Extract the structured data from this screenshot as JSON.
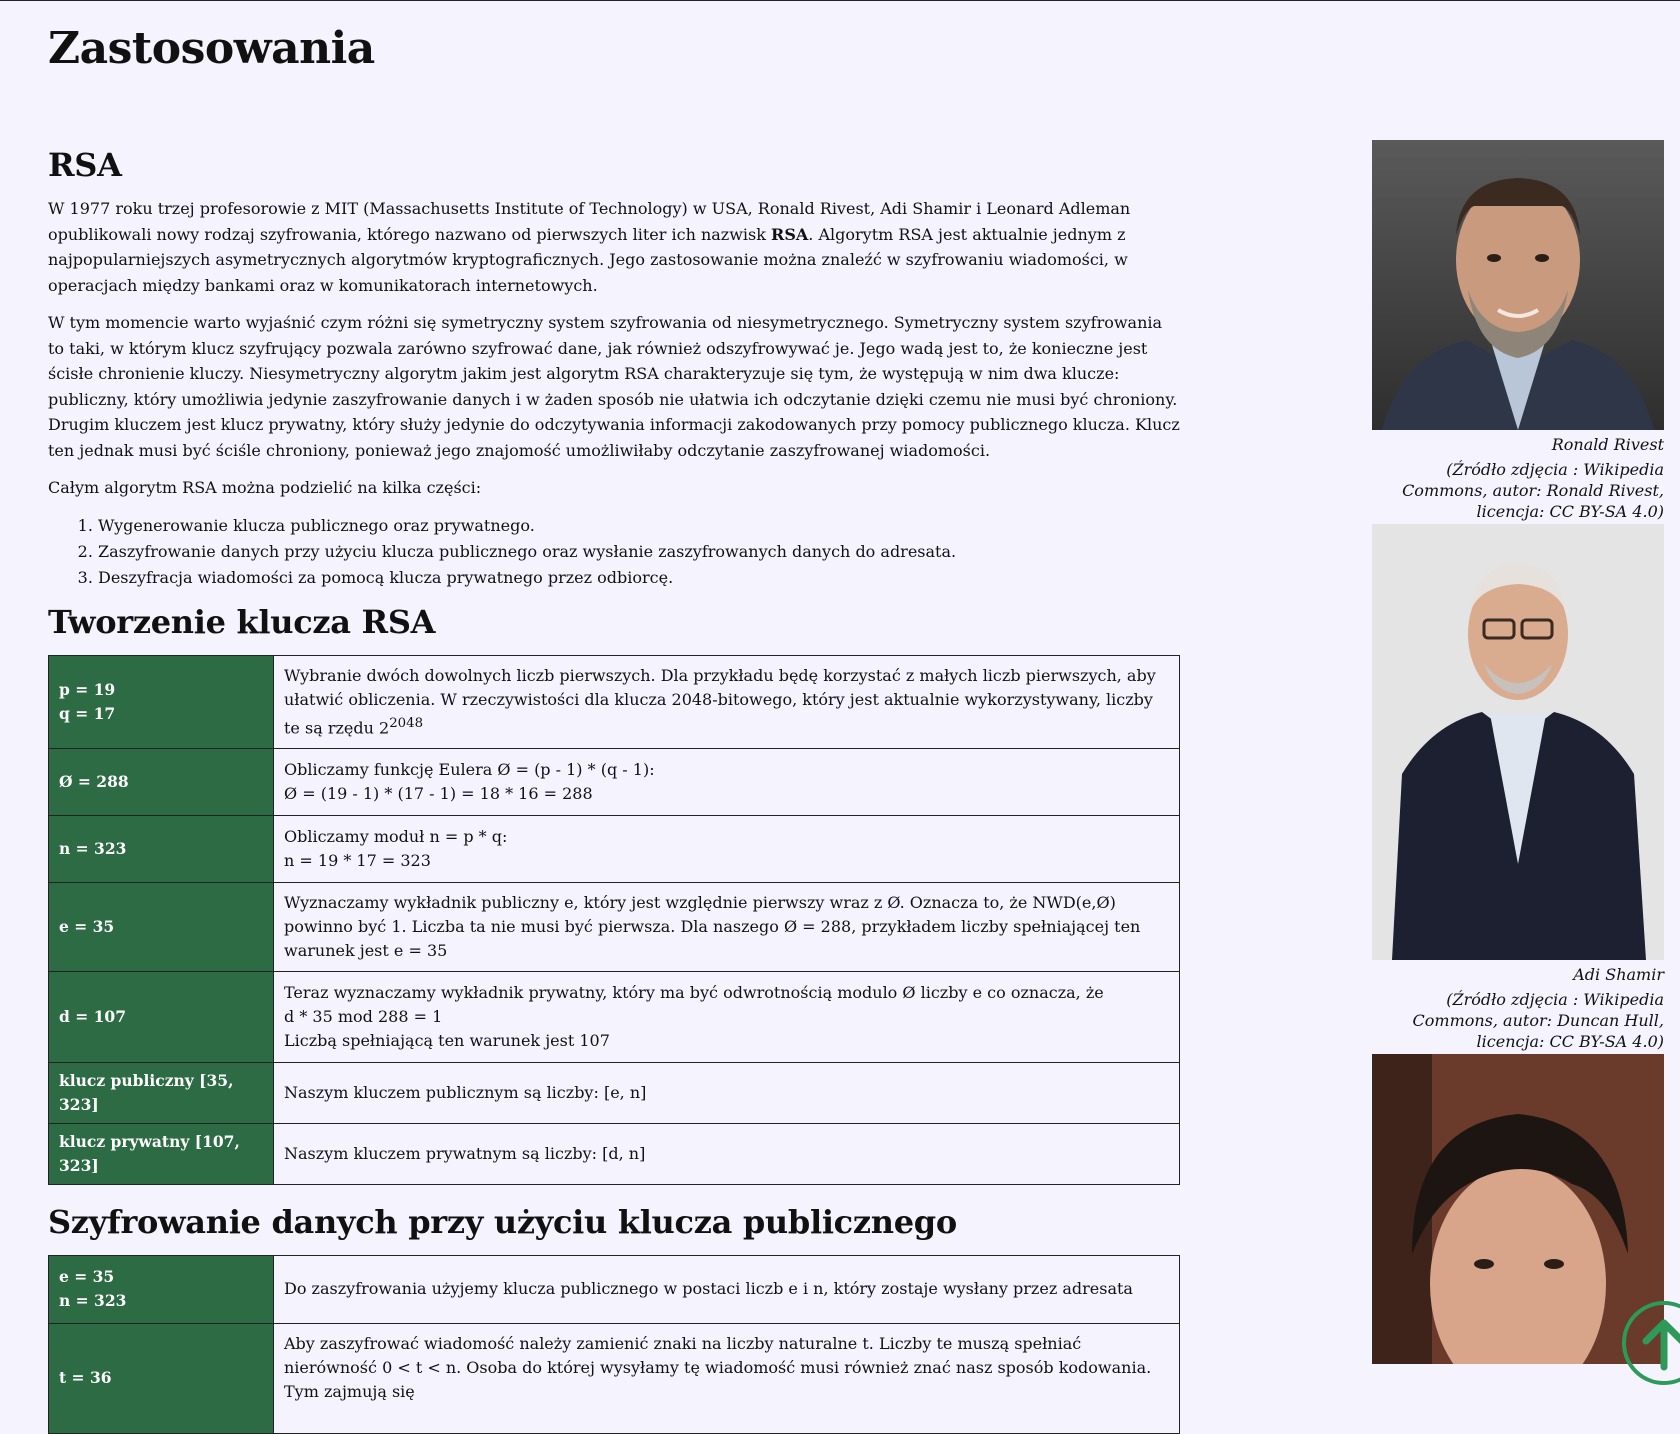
{
  "page": {
    "title": "Zastosowania"
  },
  "rsa": {
    "heading": "RSA",
    "para1_a": "W 1977 roku trzej profesorowie z MIT (Massachusetts Institute of Technology) w USA, Ronald Rivest, Adi Shamir i Leonard Adleman opublikowali nowy rodzaj szyfrowania, którego nazwano od pierwszych liter ich nazwisk ",
    "para1_bold": "RSA",
    "para1_b": ". Algorytm RSA jest aktualnie jednym z najpopularniejszych asymetrycznych algorytmów kryptograficznych. Jego zastosowanie można znaleźć w szyfrowaniu wiadomości, w operacjach między bankami oraz w komunikatorach internetowych.",
    "para2": "W tym momencie warto wyjaśnić czym różni się symetryczny system szyfrowania od niesymetrycznego. Symetryczny system szyfrowania to taki, w którym klucz szyfrujący pozwala zarówno szyfrować dane, jak również odszyfrowywać je. Jego wadą jest to, że konieczne jest ścisłe chronienie kluczy. Niesymetryczny algorytm jakim jest algorytm RSA charakteryzuje się tym, że występują w nim dwa klucze: publiczny, który umożliwia jedynie zaszyfrowanie danych i w żaden sposób nie ułatwia ich odczytanie dzięki czemu nie musi być chroniony. Drugim kluczem jest klucz prywatny, który służy jedynie do odczytywania informacji zakodowanych przy pomocy publicznego klucza. Klucz ten jednak musi być ściśle chroniony, ponieważ jego znajomość umożliwiłaby odczytanie zaszyfrowanej wiadomości.",
    "para3": "Całym algorytm RSA można podzielić na kilka części:",
    "steps": [
      "Wygenerowanie klucza publicznego oraz prywatnego.",
      "Zaszyfrowanie danych przy użyciu klucza publicznego oraz wysłanie zaszyfrowanych danych do adresata.",
      "Deszyfracja wiadomości za pomocą klucza prywatnego przez odbiorcę."
    ]
  },
  "keygen": {
    "heading": "Tworzenie klucza RSA",
    "rows": [
      {
        "k1": "p = 19",
        "k2": "q = 17",
        "v1": "Wybranie dwóch dowolnych liczb pierwszych. Dla przykładu będę korzystać z małych liczb pierwszych, aby ułatwić obliczenia. W rzeczywistości dla klucza 2048-bitowego, który jest aktualnie wykorzystywany, liczby te są rzędu 2",
        "v1_sup": "2048"
      },
      {
        "k1": "Ø = 288",
        "v1": "Obliczamy funkcję Eulera Ø = (p - 1) * (q - 1):",
        "v2": "Ø = (19 - 1) * (17 - 1) = 18 * 16 = 288"
      },
      {
        "k1": "n = 323",
        "v1": "Obliczamy moduł n = p * q:",
        "v2": "n = 19 * 17 = 323"
      },
      {
        "k1": "e = 35",
        "v1": "Wyznaczamy wykładnik publiczny e, który jest względnie pierwszy wraz z Ø. Oznacza to, że NWD(e,Ø) powinno być 1. Liczba ta nie musi być pierwsza. Dla naszego Ø = 288, przykładem liczby spełniającej ten warunek jest e = 35"
      },
      {
        "k1": "d = 107",
        "v1": "Teraz wyznaczamy wykładnik prywatny, który ma być odwrotnością modulo Ø liczby e co oznacza, że",
        "v2": "d * 35 mod 288 = 1",
        "v3": "Liczbą spełniającą ten warunek jest 107"
      },
      {
        "k1": "klucz publiczny [35, 323]",
        "v1": "Naszym kluczem publicznym są liczby: [e, n]"
      },
      {
        "k1": "klucz prywatny [107, 323]",
        "v1": "Naszym kluczem prywatnym są liczby: [d, n]"
      }
    ]
  },
  "encrypt": {
    "heading": "Szyfrowanie danych przy użyciu klucza publicznego",
    "rows": [
      {
        "k1": "e = 35",
        "k2": "n = 323",
        "v1": "Do zaszyfrowania użyjemy klucza publicznego w postaci liczb e i n, który zostaje wysłany przez adresata"
      },
      {
        "k1": "t = 36",
        "v1": "Aby zaszyfrować wiadomość należy zamienić znaki na liczby naturalne t. Liczby te muszą spełniać nierówność 0 < t < n. Osoba do której wysyłamy tę wiadomość musi również znać nasz sposób kodowania. Tym zajmują się"
      }
    ]
  },
  "sidebar": {
    "photos": [
      {
        "name": "Ronald Rivest",
        "source": "(Źródło zdjęcia : Wikipedia Commons, autor: Ronald Rivest, licencja: CC BY-SA 4.0)"
      },
      {
        "name": "Adi Shamir",
        "source": "(Źródło zdjęcia : Wikipedia Commons, autor: Duncan Hull, licencja: CC BY-SA 4.0)"
      },
      {
        "name": "",
        "source": ""
      }
    ]
  },
  "icons": {
    "scroll_top": "arrow-up-circle-icon"
  },
  "colors": {
    "background": "#f5f3fe",
    "table_key_bg": "#2d6b45",
    "scroll_button": "#2d9a5a"
  }
}
